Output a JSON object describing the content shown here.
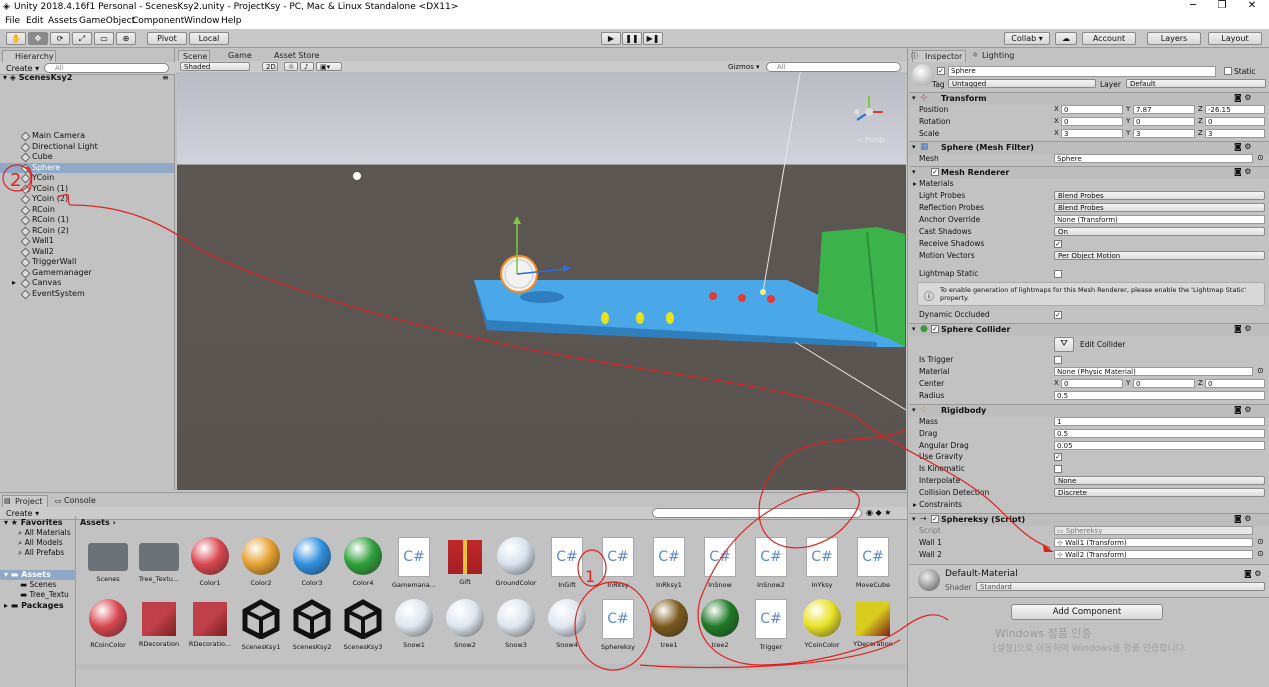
{
  "window": {
    "title": "Unity 2018.4.16f1 Personal - ScenesKsy2.unity - ProjectKsy - PC, Mac & Linux Standalone <DX11>",
    "minimize": "─",
    "maximize": "❐",
    "close": "✕"
  },
  "menu": [
    "File",
    "Edit",
    "Assets",
    "GameObject",
    "Component",
    "Window",
    "Help"
  ],
  "toolbar": {
    "tools": [
      "✋",
      "✥",
      "⟳",
      "⤢",
      "▭",
      "⊕"
    ],
    "pivot": "Pivot",
    "local": "Local",
    "play": "▶",
    "pause": "❚❚",
    "step": "▶❚",
    "collab": "Collab ▾",
    "cloud": "☁",
    "account": "Account",
    "layers": "Layers",
    "layout": "Layout"
  },
  "hierarchy": {
    "tab": "Hierarchy",
    "create": "Create ▾",
    "search": "All",
    "scene": "ScenesKsy2",
    "items": [
      "Main Camera",
      "Directional Light",
      "Cube",
      "Sphere",
      "YCoin",
      "YCoin (1)",
      "YCoin (2)",
      "RCoin",
      "RCoin (1)",
      "RCoin (2)",
      "Wall1",
      "Wall2",
      "TriggerWall",
      "Gamemanager",
      "Canvas",
      "EventSystem"
    ],
    "selected_index": 3
  },
  "scene_view": {
    "tabs": [
      "Scene",
      "Game",
      "Asset Store"
    ],
    "shading": "Shaded",
    "mode_2d": "2D",
    "gizmos": "Gizmos ▾",
    "search": "All",
    "persp": "< Persp"
  },
  "inspector": {
    "tabs": [
      "Inspector",
      "Lighting"
    ],
    "object_name": "Sphere",
    "static_label": "Static",
    "tag_label": "Tag",
    "tag_value": "Untagged",
    "layer_label": "Layer",
    "layer_value": "Default",
    "transform": {
      "title": "Transform",
      "position_label": "Position",
      "position": [
        "0",
        "7.87",
        "-26.15"
      ],
      "rotation_label": "Rotation",
      "rotation": [
        "0",
        "0",
        "0"
      ],
      "scale_label": "Scale",
      "scale": [
        "3",
        "3",
        "3"
      ]
    },
    "mesh_filter": {
      "title": "Sphere (Mesh Filter)",
      "mesh_label": "Mesh",
      "mesh_value": "Sphere"
    },
    "mesh_renderer": {
      "title": "Mesh Renderer",
      "materials_label": "Materials",
      "rows": [
        {
          "label": "Light Probes",
          "value": "Blend Probes",
          "kind": "dropdown"
        },
        {
          "label": "Reflection Probes",
          "value": "Blend Probes",
          "kind": "dropdown"
        },
        {
          "label": "Anchor Override",
          "value": "None (Transform)",
          "kind": "field"
        },
        {
          "label": "Cast Shadows",
          "value": "On",
          "kind": "dropdown"
        },
        {
          "label": "Receive Shadows",
          "value": "✓",
          "kind": "check"
        },
        {
          "label": "Motion Vectors",
          "value": "Per Object Motion",
          "kind": "dropdown"
        }
      ],
      "lightmap_static": "Lightmap Static",
      "info": "To enable generation of lightmaps for this Mesh Renderer, please enable the 'Lightmap Static' property.",
      "dynamic_occluded": "Dynamic Occluded"
    },
    "sphere_collider": {
      "title": "Sphere Collider",
      "edit_collider": "Edit Collider",
      "is_trigger": "Is Trigger",
      "material_label": "Material",
      "material_value": "None (Physic Material)",
      "center_label": "Center",
      "center": [
        "0",
        "0",
        "0"
      ],
      "radius_label": "Radius",
      "radius": "0.5"
    },
    "rigidbody": {
      "title": "Rigidbody",
      "mass_label": "Mass",
      "mass": "1",
      "drag_label": "Drag",
      "drag": "0.5",
      "angular_drag_label": "Angular Drag",
      "angular_drag": "0.05",
      "use_gravity_label": "Use Gravity",
      "is_kinematic_label": "Is Kinematic",
      "interpolate_label": "Interpolate",
      "interpolate": "None",
      "collision_label": "Collision Detection",
      "collision": "Discrete",
      "constraints_label": "Constraints"
    },
    "script_comp": {
      "title": "Sphereksy (Script)",
      "script_label": "Script",
      "script_value": "Sphereksy",
      "wall1_label": "Wall 1",
      "wall1_value": "Wall1 (Transform)",
      "wall2_label": "Wall 2",
      "wall2_value": "Wall2 (Transform)"
    },
    "material": {
      "name": "Default-Material",
      "shader_label": "Shader",
      "shader_value": "Standard"
    },
    "add_component": "Add Component"
  },
  "project": {
    "tabs": [
      "Project",
      "Console"
    ],
    "create": "Create ▾",
    "favorites_label": "Favorites",
    "favorites": [
      "All Materials",
      "All Models",
      "All Prefabs"
    ],
    "assets_label": "Assets",
    "asset_folders": [
      "Scenes",
      "Tree_Textu"
    ],
    "packages_label": "Packages",
    "breadcrumb": "Assets ›",
    "row1": [
      {
        "name": "Scenes",
        "kind": "folder"
      },
      {
        "name": "Tree_Textu...",
        "kind": "folder"
      },
      {
        "name": "Color1",
        "kind": "sphere",
        "color": "#d9464f"
      },
      {
        "name": "Color2",
        "kind": "sphere",
        "color": "#e6a02f"
      },
      {
        "name": "Color3",
        "kind": "sphere",
        "color": "#2f8fe0"
      },
      {
        "name": "Color4",
        "kind": "sphere",
        "color": "#2ea03a"
      },
      {
        "name": "Gamemana...",
        "kind": "script"
      },
      {
        "name": "Gift",
        "kind": "gift"
      },
      {
        "name": "GroundColor",
        "kind": "sphere",
        "color": "#d8e2ec"
      },
      {
        "name": "InGift",
        "kind": "script"
      },
      {
        "name": "InRksy",
        "kind": "script"
      },
      {
        "name": "InRksy1",
        "kind": "script"
      },
      {
        "name": "InSnow",
        "kind": "script"
      },
      {
        "name": "InSnow2",
        "kind": "script"
      },
      {
        "name": "InYksy",
        "kind": "script"
      },
      {
        "name": "MoveCube",
        "kind": "script"
      }
    ],
    "row2": [
      {
        "name": "RCoinColor",
        "kind": "sphere",
        "color": "#d9464f"
      },
      {
        "name": "RDecoration",
        "kind": "cube",
        "color": "#c0404a"
      },
      {
        "name": "RDecoratio...",
        "kind": "cube",
        "color": "#c0404a"
      },
      {
        "name": "ScenesKsy1",
        "kind": "unity"
      },
      {
        "name": "ScenesKsy2",
        "kind": "unity"
      },
      {
        "name": "ScenesKsy3",
        "kind": "unity"
      },
      {
        "name": "Snow1",
        "kind": "sphere",
        "color": "#dfe6ee"
      },
      {
        "name": "Snow2",
        "kind": "sphere",
        "color": "#dfe6ee"
      },
      {
        "name": "Snow3",
        "kind": "sphere",
        "color": "#dfe6ee"
      },
      {
        "name": "Snow4",
        "kind": "sphere",
        "color": "#dfe6ee"
      },
      {
        "name": "Sphereksy",
        "kind": "script"
      },
      {
        "name": "tree1",
        "kind": "sphere",
        "color": "#7a5a1c"
      },
      {
        "name": "tree2",
        "kind": "sphere",
        "color": "#1f7a26"
      },
      {
        "name": "Trigger",
        "kind": "script"
      },
      {
        "name": "YCoinColor",
        "kind": "sphere",
        "color": "#e9e224"
      },
      {
        "name": "YDecoration",
        "kind": "cube",
        "color": "#d8cc1e"
      }
    ]
  },
  "annotations": {
    "one": "1",
    "two": "2"
  },
  "watermark": {
    "line1": "Windows 정품 인증",
    "line2": "[설정]으로 이동하여 Windows를 정품 인증합니다."
  },
  "colors": {
    "selection": "#8fa8c8",
    "annotation": "#e02020",
    "scene_platform": "#4aa8e8",
    "wall": "#3cb34a"
  }
}
